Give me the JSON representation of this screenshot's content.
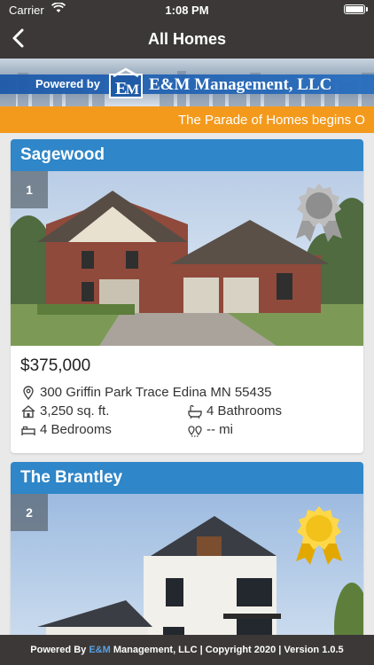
{
  "status": {
    "carrier": "Carrier",
    "time": "1:08 PM"
  },
  "nav": {
    "title": "All Homes",
    "back_icon": "chevron-left-icon"
  },
  "banner": {
    "powered_by": "Powered by",
    "company": "E&M Management, LLC"
  },
  "ticker": {
    "text": "The Parade of Homes begins O"
  },
  "homes": [
    {
      "name": "Sagewood",
      "rank": "1",
      "badge": "silver-award-icon",
      "price": "$375,000",
      "address": "300 Griffin Park Trace Edina MN 55435",
      "sqft": "3,250 sq. ft.",
      "bathrooms": "4 Bathrooms",
      "bedrooms": "4 Bedrooms",
      "distance": "-- mi"
    },
    {
      "name": "The Brantley",
      "rank": "2",
      "badge": "gold-award-icon"
    }
  ],
  "footer": {
    "prefix": "Powered By ",
    "brand": "E&M",
    "suffix": " Management, LLC | Copyright 2020 | Version 1.0.5"
  },
  "colors": {
    "header_bg": "#3b3837",
    "card_header": "#2f86c8",
    "ticker": "#f39a1d"
  }
}
